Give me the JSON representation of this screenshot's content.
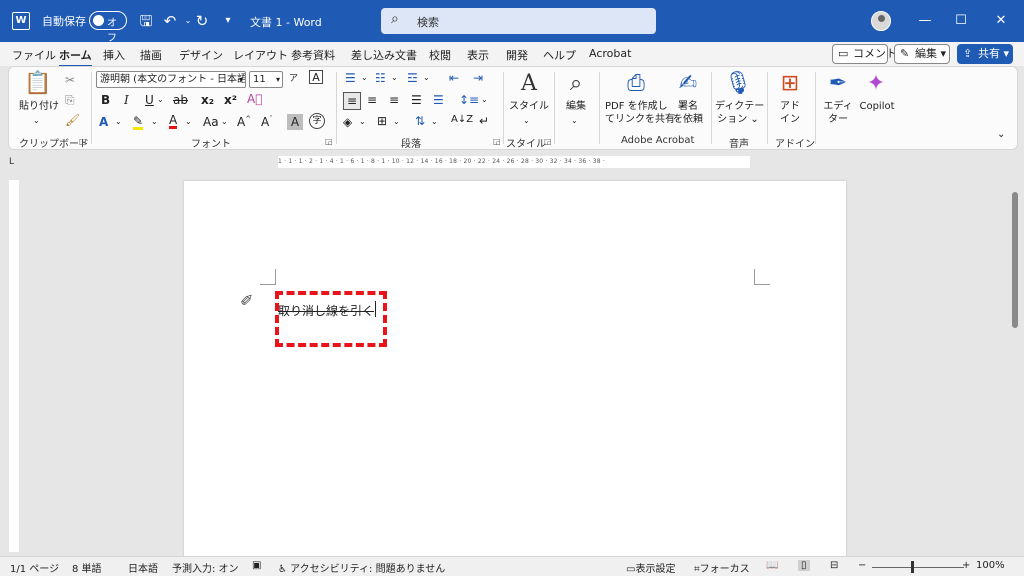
{
  "titlebar": {
    "autosave_label": "自動保存",
    "autosave_state": "オフ",
    "document_title": "文書 1  -  Word",
    "search_placeholder": "検索",
    "minimize": "—",
    "maximize": "☐",
    "close": "✕"
  },
  "menu": {
    "tabs": [
      "ファイル",
      "ホーム",
      "挿入",
      "描画",
      "デザイン",
      "レイアウト",
      "参考資料",
      "差し込み文書",
      "校閲",
      "表示",
      "開発",
      "ヘルプ",
      "Acrobat"
    ],
    "active_tab": "ホーム",
    "comment_button": "コメント",
    "edit_button": "編集",
    "share_button": "共有"
  },
  "ribbon": {
    "clipboard": {
      "paste": "貼り付け",
      "label": "クリップボード"
    },
    "font": {
      "font_name": "游明朝 (本文のフォント - 日本語)",
      "font_size": "11",
      "label": "フォント",
      "bold": "B",
      "italic": "I",
      "underline": "U",
      "strike": "ab",
      "subscript": "x₂",
      "superscript": "x²",
      "font_case": "Aa",
      "grow": "A",
      "shrink": "A"
    },
    "paragraph": {
      "label": "段落"
    },
    "styles": {
      "button": "スタイル",
      "label": "スタイル"
    },
    "editing": {
      "button": "編集"
    },
    "acrobat": {
      "create_pdf_line1": "PDF を作成し",
      "create_pdf_line2": "てリンクを共有",
      "sign_line1": "署名",
      "sign_line2": "を依頼",
      "label": "Adobe Acrobat"
    },
    "voice": {
      "dictate_line1": "ディクテー",
      "dictate_line2": "ション",
      "label": "音声"
    },
    "addins": {
      "button_line1": "アド",
      "button_line2": "イン",
      "label": "アドイン"
    },
    "editor": {
      "button_line1": "エディ",
      "button_line2": "ター"
    },
    "copilot": {
      "button": "Copilot"
    }
  },
  "ruler": {
    "ticks": "1 · 1 · 1 · 2 · 1 · 4 · 1 · 6 · 1 · 8 · 1 · 10 · 12 · 14 · 16 · 18 · 20 · 22 · 24 · 26 · 28 · 30 · 32 · 34 · 36 · 38 ·"
  },
  "document": {
    "text": "取り消し線を引く"
  },
  "statusbar": {
    "page": "1/1 ページ",
    "words": "8 単語",
    "language": "日本語",
    "prediction": "予測入力: オン",
    "accessibility": "アクセシビリティ: 問題ありません",
    "display_settings": "表示設定",
    "focus": "フォーカス",
    "zoom_minus": "−",
    "zoom_plus": "+",
    "zoom": "100%"
  },
  "colors": {
    "titlebar": "#1f5ab5",
    "highlight_box": "#e8141a"
  }
}
